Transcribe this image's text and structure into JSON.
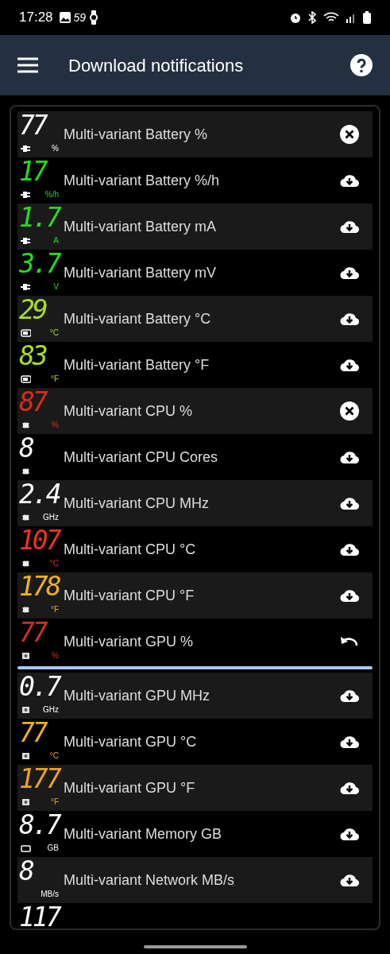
{
  "status_bar": {
    "time": "17:28",
    "app_badge": "59"
  },
  "app_bar": {
    "title": "Download notifications"
  },
  "items": [
    {
      "kind": "row",
      "value": "77",
      "unit": "%",
      "device": {
        "kind": "plug"
      },
      "color": "#ffffff",
      "label": "Multi-variant Battery %",
      "action": {
        "kind": "remove"
      }
    },
    {
      "kind": "row",
      "value": "17",
      "unit": "%/h",
      "device": {
        "kind": "plug"
      },
      "color": "#22dd22",
      "label": "Multi-variant Battery %/h",
      "action": {
        "kind": "download"
      }
    },
    {
      "kind": "row",
      "value": "1.7",
      "unit": "A",
      "device": {
        "kind": "plug"
      },
      "color": "#22dd22",
      "label": "Multi-variant Battery mA",
      "action": {
        "kind": "download"
      }
    },
    {
      "kind": "row",
      "value": "3.7",
      "unit": "V",
      "device": {
        "kind": "plug"
      },
      "color": "#22dd22",
      "label": "Multi-variant Battery mV",
      "action": {
        "kind": "download"
      }
    },
    {
      "kind": "row",
      "value": "29",
      "unit": "°C",
      "device": {
        "kind": "battery"
      },
      "color": "#aadd22",
      "label": "Multi-variant Battery °C",
      "action": {
        "kind": "download"
      }
    },
    {
      "kind": "row",
      "value": "83",
      "unit": "°F",
      "device": {
        "kind": "battery"
      },
      "color": "#aadd22",
      "label": "Multi-variant Battery °F",
      "action": {
        "kind": "download"
      }
    },
    {
      "kind": "row",
      "value": "87",
      "unit": "%",
      "device": {
        "kind": "chip"
      },
      "color": "#dd2a1a",
      "label": "Multi-variant CPU %",
      "action": {
        "kind": "remove"
      }
    },
    {
      "kind": "row",
      "value": "8",
      "device": {
        "kind": "chip"
      },
      "color": "#ffffff",
      "label": "Multi-variant CPU Cores",
      "action": {
        "kind": "download"
      }
    },
    {
      "kind": "row",
      "value": "2.4",
      "unit": "GHz",
      "device": {
        "kind": "chip"
      },
      "color": "#ffffff",
      "label": "Multi-variant CPU MHz",
      "action": {
        "kind": "download"
      }
    },
    {
      "kind": "row",
      "value": "107",
      "unit": "°C",
      "device": {
        "kind": "chip"
      },
      "color": "#ee3322",
      "label": "Multi-variant CPU °C",
      "action": {
        "kind": "download"
      }
    },
    {
      "kind": "row",
      "value": "178",
      "unit": "°F",
      "device": {
        "kind": "chip"
      },
      "color": "#f0b020",
      "label": "Multi-variant CPU °F",
      "action": {
        "kind": "download"
      }
    },
    {
      "kind": "row",
      "value": "77",
      "unit": "%",
      "device": {
        "kind": "gpu"
      },
      "color": "#cc3322",
      "label": "Multi-variant GPU %",
      "action": {
        "kind": "undo"
      }
    },
    {
      "kind": "separator"
    },
    {
      "kind": "row",
      "value": "0.7",
      "unit": "GHz",
      "device": {
        "kind": "gpu"
      },
      "color": "#ffffff",
      "label": "Multi-variant GPU MHz",
      "action": {
        "kind": "download"
      }
    },
    {
      "kind": "row",
      "value": "77",
      "unit": "°C",
      "device": {
        "kind": "gpu"
      },
      "color": "#f0b020",
      "label": "Multi-variant GPU °C",
      "action": {
        "kind": "download"
      }
    },
    {
      "kind": "row",
      "value": "177",
      "unit": "°F",
      "device": {
        "kind": "gpu"
      },
      "color": "#f0a020",
      "label": "Multi-variant GPU °F",
      "action": {
        "kind": "download"
      }
    },
    {
      "kind": "row",
      "value": "8.7",
      "unit": "GB",
      "device": {
        "kind": "memory"
      },
      "color": "#ffffff",
      "label": "Multi-variant Memory GB",
      "action": {
        "kind": "download"
      }
    },
    {
      "kind": "row",
      "value": "8",
      "unit": "MB/s",
      "color": "#ffffff",
      "label": "Multi-variant Network MB/s",
      "action": {
        "kind": "download"
      }
    },
    {
      "kind": "row",
      "value": "117",
      "color": "#ffffff"
    }
  ]
}
